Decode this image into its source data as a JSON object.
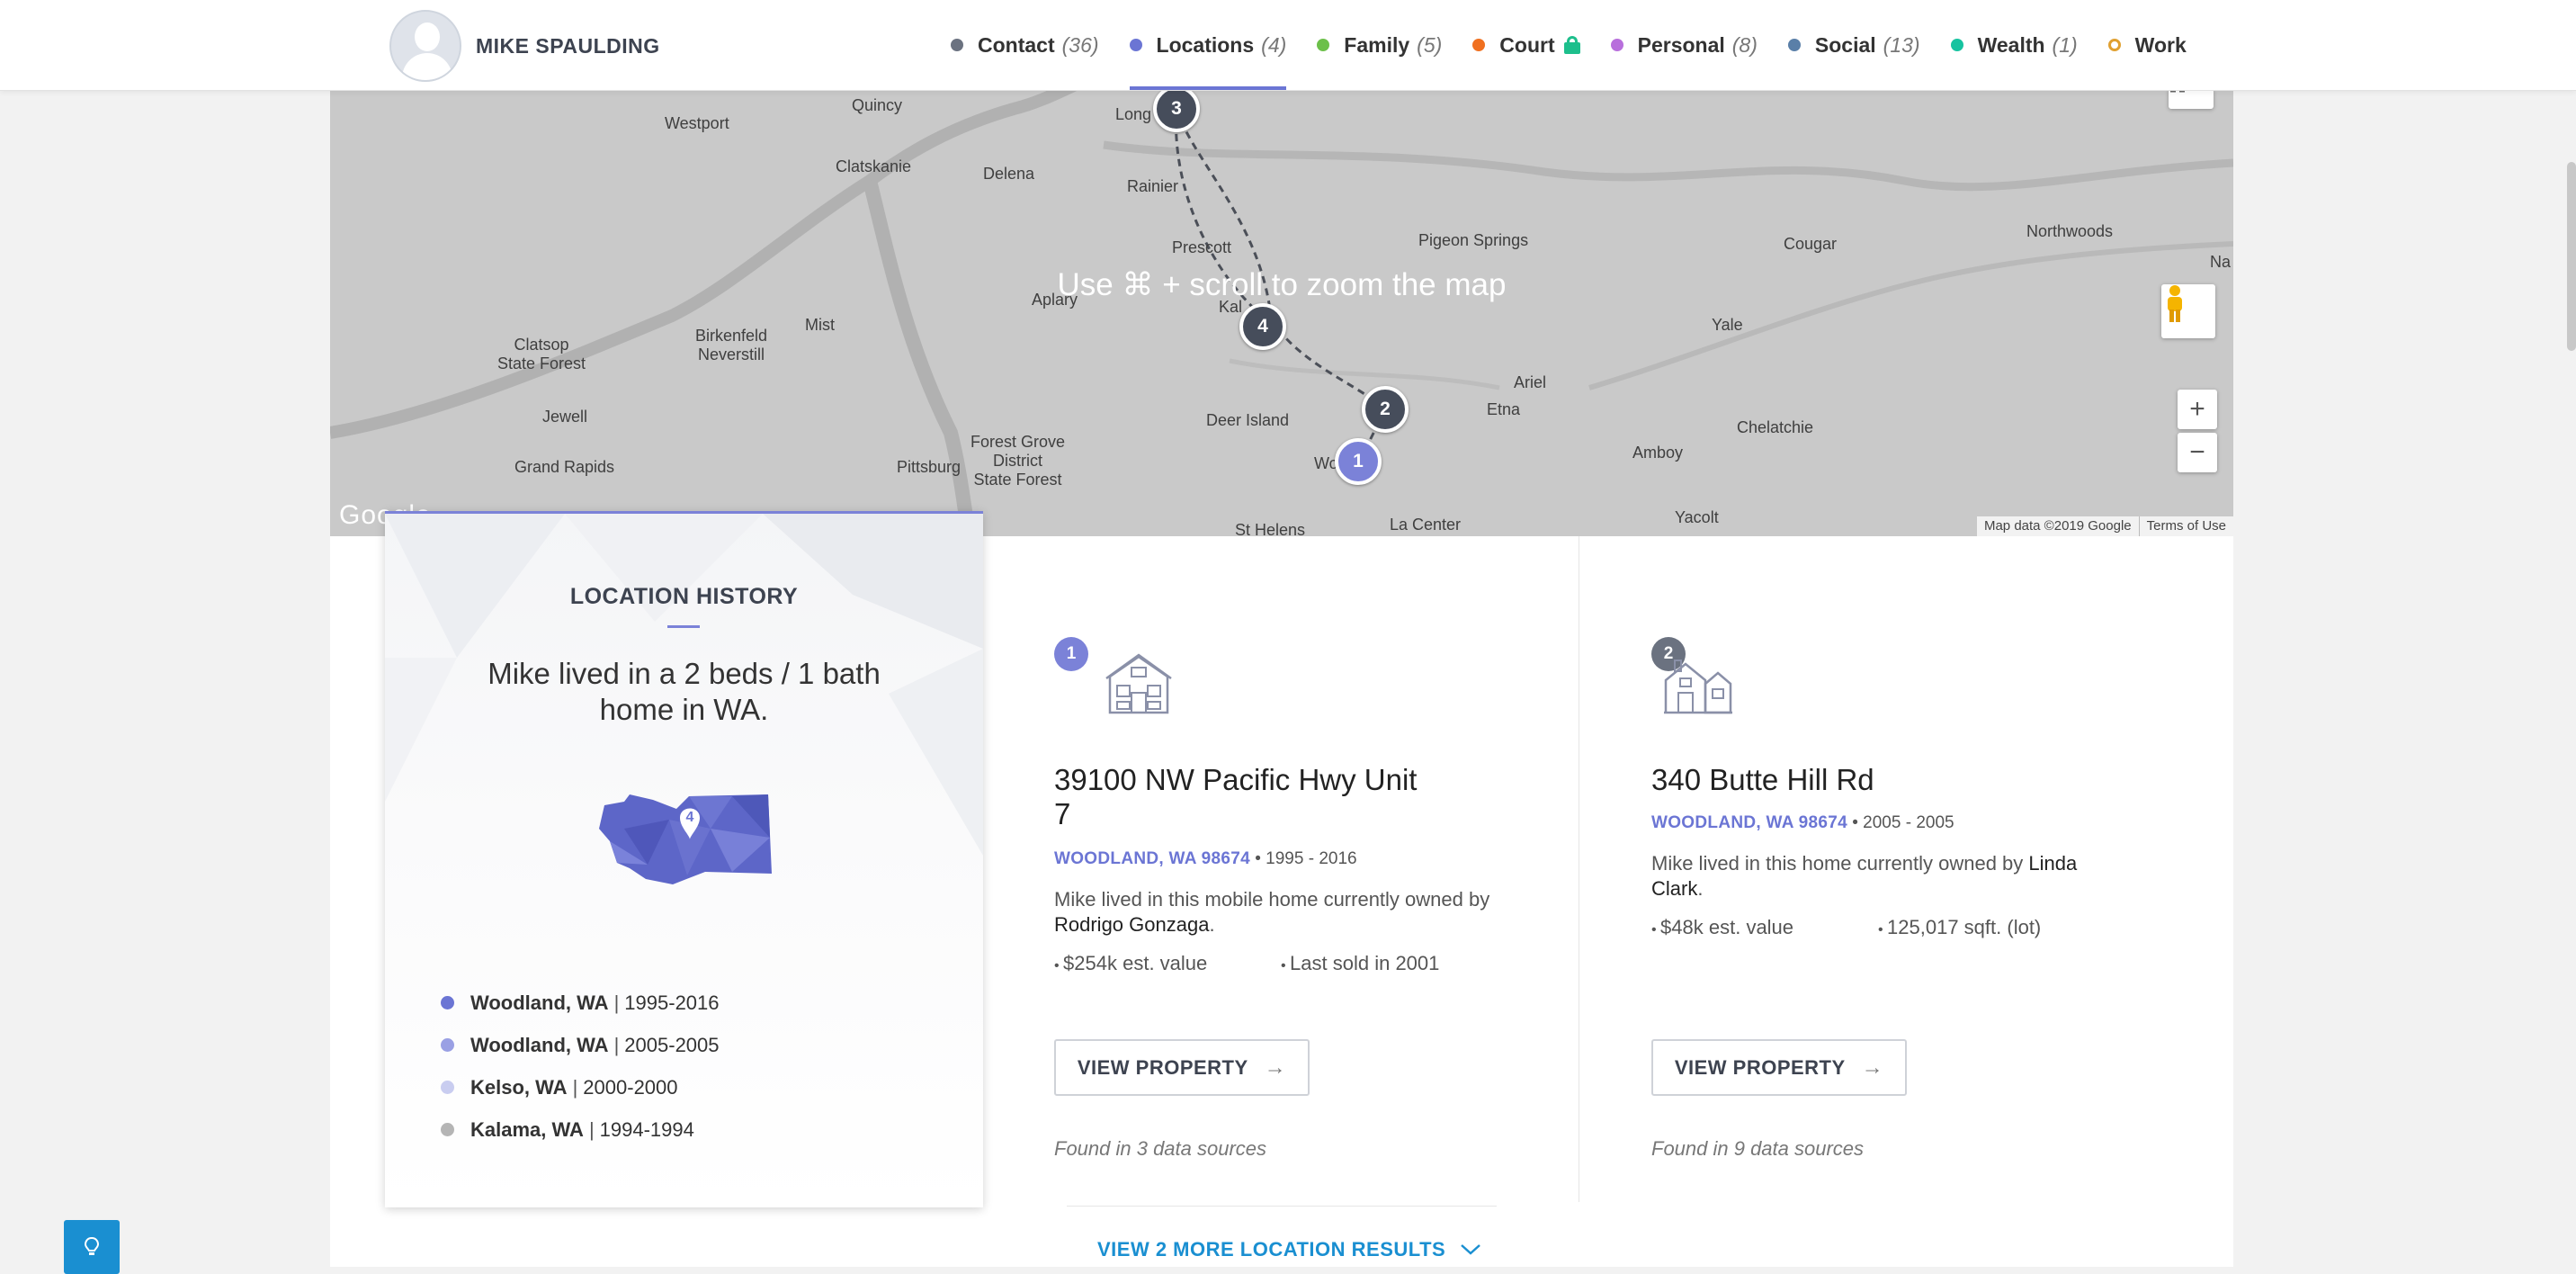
{
  "header": {
    "name": "MIKE SPAULDING",
    "tabs": [
      {
        "label": "Contact",
        "count": "(36)",
        "color": "#6b7280"
      },
      {
        "label": "Locations",
        "count": "(4)",
        "color": "#6b75d4"
      },
      {
        "label": "Family",
        "count": "(5)",
        "color": "#6cc04a"
      },
      {
        "label": "Court",
        "count": "",
        "color": "#f07020",
        "icon": "lock-icon"
      },
      {
        "label": "Personal",
        "count": "(8)",
        "color": "#b86fdc"
      },
      {
        "label": "Social",
        "count": "(13)",
        "color": "#5a7fa8"
      },
      {
        "label": "Wealth",
        "count": "(1)",
        "color": "#16c3a0"
      },
      {
        "label": "Work",
        "count": "",
        "color": "#e0a030"
      }
    ],
    "active_tab": "Locations"
  },
  "map": {
    "zoom_hint": "Use ⌘ + scroll to zoom the map",
    "google_logo": "Google",
    "attribution": "Map data ©2019 Google",
    "terms": "Terms of Use",
    "labels": {
      "westport": "Westport",
      "quincy": "Quincy",
      "longview": "Long",
      "clatskanie": "Clatskanie",
      "delena": "Delena",
      "rainier": "Rainier",
      "prescott": "Prescott",
      "pigeon_springs": "Pigeon Springs",
      "cougar": "Cougar",
      "northwoods": "Northwoods",
      "na": "Na",
      "aplary": "Aplary",
      "kalama": "Kal",
      "clatsop": "Clatsop\nState Forest",
      "birkenfeld": "Birkenfeld\nNeverstill",
      "mist": "Mist",
      "yale": "Yale",
      "ariel": "Ariel",
      "etna": "Etna",
      "chelatchie": "Chelatchie",
      "jewell": "Jewell",
      "deer_island": "Deer Island",
      "amboy": "Amboy",
      "grand_rapids": "Grand Rapids",
      "pittsburg": "Pittsburg",
      "forest_grove": "Forest Grove\nDistrict\nState Forest",
      "woodland": "Wo",
      "st_helens": "St Helens",
      "la_center": "La Center",
      "yacolt": "Yacolt"
    },
    "pins": [
      "1",
      "2",
      "3",
      "4"
    ],
    "zoom_in": "+",
    "zoom_out": "−"
  },
  "history": {
    "title": "LOCATION HISTORY",
    "summary": "Mike lived in a 2 beds / 1 bath home in WA.",
    "state_pin": "4",
    "items": [
      {
        "city": "Woodland, WA",
        "years": "1995-2016",
        "color": "#6b75d4"
      },
      {
        "city": "Woodland, WA",
        "years": "2005-2005",
        "color": "#9aa0e4"
      },
      {
        "city": "Kelso, WA",
        "years": "2000-2000",
        "color": "#c9cdf0"
      },
      {
        "city": "Kalama, WA",
        "years": "1994-1994",
        "color": "#b5b5b5"
      }
    ]
  },
  "properties": [
    {
      "num": "1",
      "num_color": "#7b82d8",
      "address": "39100 NW Pacific Hwy Unit 7",
      "location": "WOODLAND, WA 98674",
      "years": "1995 - 2016",
      "desc": "Mike lived in this mobile home currently owned by",
      "owner": "Rodrigo Gonzaga",
      "stat1": "$254k est. value",
      "stat2": "Last sold in 2001",
      "button": "VIEW PROPERTY",
      "sources": "Found in 3 data sources"
    },
    {
      "num": "2",
      "num_color": "#6b7280",
      "address": "340 Butte Hill Rd",
      "location": "WOODLAND, WA 98674",
      "years": "2005 - 2005",
      "desc": "Mike lived in this home currently owned by",
      "owner": "Linda Clark",
      "stat1": "$48k est. value",
      "stat2": "125,017 sqft. (lot)",
      "button": "VIEW PROPERTY",
      "sources": "Found in 9 data sources"
    }
  ],
  "more_results": "VIEW 2 MORE LOCATION RESULTS"
}
